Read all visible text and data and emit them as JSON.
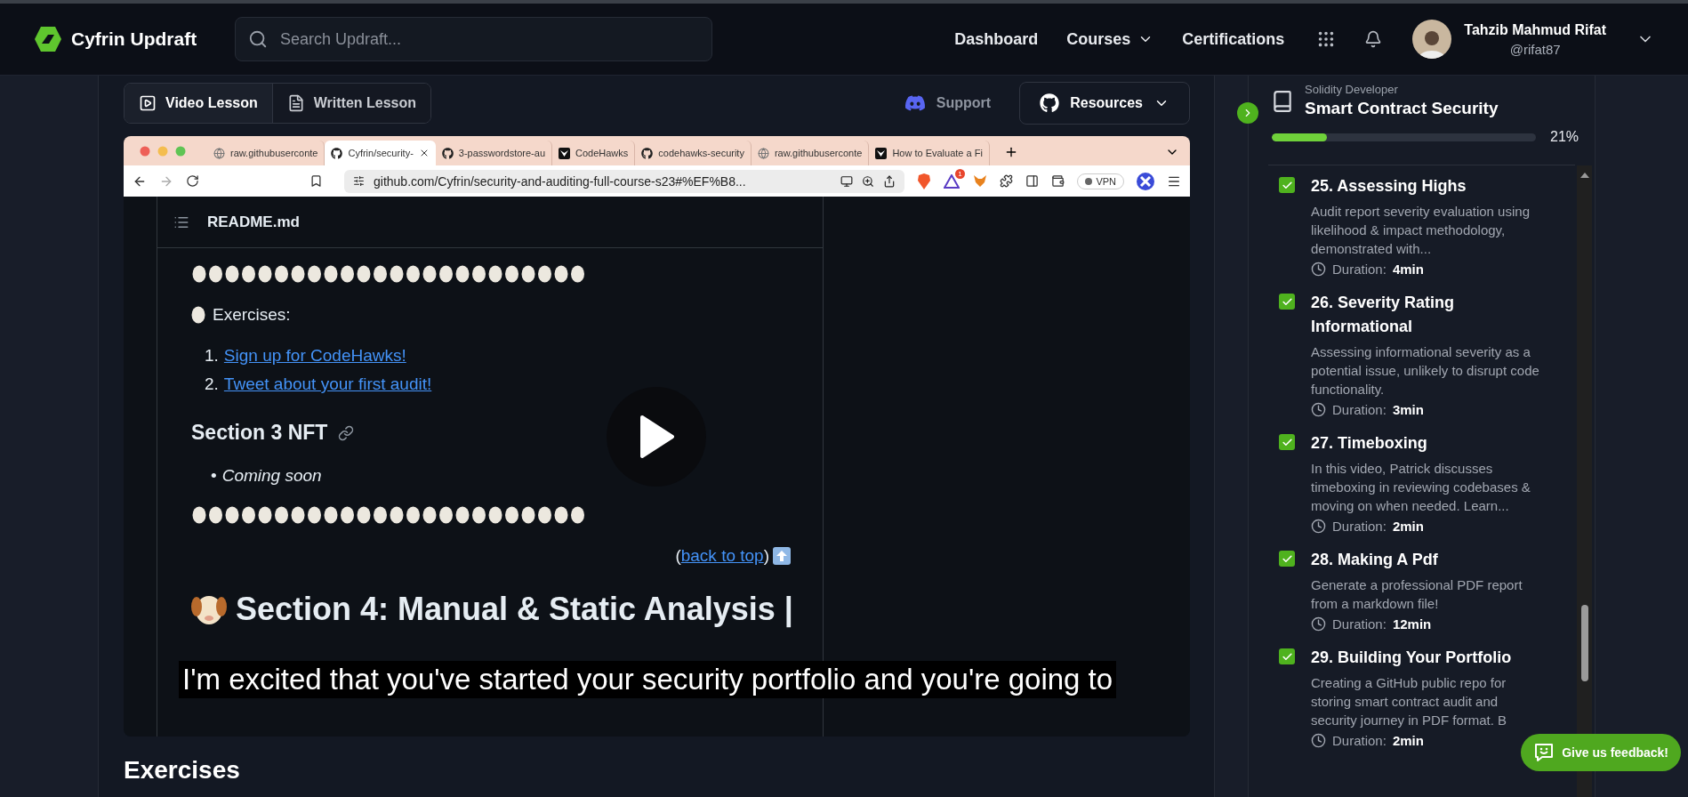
{
  "nav": {
    "logo": "Cyfrin Updraft",
    "search": {
      "placeholder": "Search Updraft..."
    },
    "links": [
      {
        "label": "Dashboard",
        "dropdown": false
      },
      {
        "label": "Courses",
        "dropdown": true
      },
      {
        "label": "Certifications",
        "dropdown": false
      }
    ],
    "user": {
      "name": "Tahzib Mahmud Rifat",
      "handle": "@rifat87"
    }
  },
  "lesson_tabs": [
    {
      "label": "Video Lesson",
      "kind": "video",
      "selected": true
    },
    {
      "label": "Written Lesson",
      "kind": "written",
      "selected": false
    }
  ],
  "support": "Support",
  "resources": "Resources",
  "video": {
    "browser": {
      "tabs": [
        {
          "title": "raw.githubuserconte",
          "selected": false
        },
        {
          "title": "Cyfrin/security-",
          "selected": true
        },
        {
          "title": "3-passwordstore-au",
          "selected": false
        },
        {
          "title": "CodeHawks",
          "selected": false
        },
        {
          "title": "codehawks-security",
          "selected": false
        },
        {
          "title": "raw.githubuserconte",
          "selected": false
        },
        {
          "title": "How to Evaluate a Fi",
          "selected": false
        }
      ],
      "url": "github.com/Cyfrin/security-and-auditing-full-course-s23#%EF%B8...",
      "vpn": "VPN",
      "badge": "1"
    },
    "readme": {
      "file": "README.md",
      "exercises_label": "Exercises:",
      "links": [
        {
          "number": "1.",
          "text": "Sign up for CodeHawks!"
        },
        {
          "number": "2.",
          "text": "Tweet about your first audit!"
        }
      ],
      "section3": "Section 3 NFT",
      "bullets": [
        {
          "mark": "•",
          "text": "Coming soon"
        }
      ],
      "back_line": {
        "before": "(",
        "link": "back to top",
        "after": ")"
      },
      "section4": "Section 4: Manual & Static Analysis |"
    },
    "caption": "I'm excited that you've started your security portfolio and you're going to"
  },
  "below_heading": "Exercises",
  "sidebar": {
    "path": "Solidity Developer",
    "course": "Smart Contract Security",
    "progress": {
      "level": 0.21,
      "label": "21%"
    },
    "lessons": [
      {
        "title": "25. Assessing Highs",
        "description": "Audit report severity evaluation using likelihood & impact methodology, demonstrated with...",
        "duration_label": "Duration:",
        "duration": "4min",
        "completed": true
      },
      {
        "title": "26. Severity Rating Informational",
        "description": "Assessing informational severity as a potential issue, unlikely to disrupt code functionality.",
        "duration_label": "Duration:",
        "duration": "3min",
        "completed": true
      },
      {
        "title": "27. Timeboxing",
        "description": "In this video, Patrick discusses timeboxing in reviewing codebases & moving on when needed. Learn...",
        "duration_label": "Duration:",
        "duration": "2min",
        "completed": true
      },
      {
        "title": "28. Making A Pdf",
        "description": "Generate a professional PDF report from a markdown file!",
        "duration_label": "Duration:",
        "duration": "12min",
        "completed": true
      },
      {
        "title": "29. Building Your Portfolio",
        "description": "Creating a GitHub public repo for storing smart contract audit and security journey in PDF format. B",
        "duration_label": "Duration:",
        "duration": "2min",
        "completed": true
      }
    ]
  },
  "feedback": "Give us feedback!"
}
